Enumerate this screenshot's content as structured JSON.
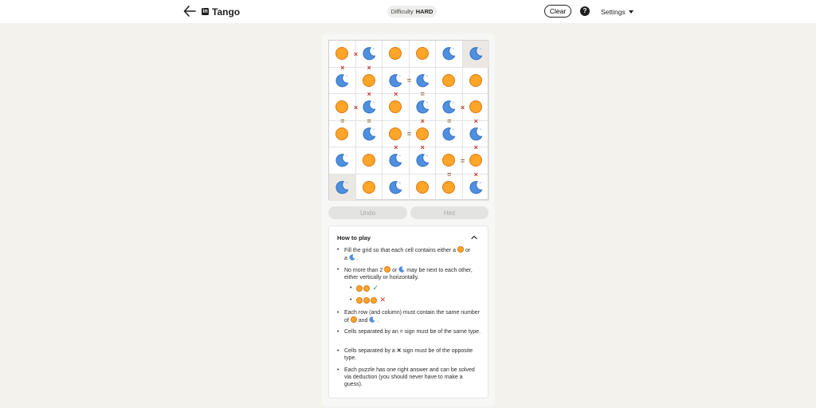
{
  "header": {
    "app_name": "Tango",
    "brand_logo": "in",
    "difficulty_label": "Difficulty",
    "difficulty_value": "HARD",
    "clear_label": "Clear",
    "help_label": "?",
    "settings_label": "Settings"
  },
  "board": {
    "size": 6,
    "cells": [
      [
        "sun",
        "moon",
        "sun",
        "sun",
        "moon",
        "moon"
      ],
      [
        "moon",
        "sun",
        "moon",
        "moon",
        "sun",
        "sun"
      ],
      [
        "sun",
        "moon",
        "sun",
        "moon",
        "moon",
        "sun"
      ],
      [
        "sun",
        "moon",
        "sun",
        "sun",
        "moon",
        "moon"
      ],
      [
        "moon",
        "sun",
        "moon",
        "moon",
        "sun",
        "sun"
      ],
      [
        "moon",
        "sun",
        "moon",
        "sun",
        "sun",
        "moon"
      ]
    ],
    "locked": [
      [
        0,
        5
      ],
      [
        5,
        0
      ]
    ],
    "h_signs": [
      {
        "row": 0,
        "col": 0,
        "sign": "×"
      },
      {
        "row": 1,
        "col": 2,
        "sign": "="
      },
      {
        "row": 2,
        "col": 0,
        "sign": "×"
      },
      {
        "row": 2,
        "col": 4,
        "sign": "×"
      },
      {
        "row": 3,
        "col": 2,
        "sign": "="
      },
      {
        "row": 4,
        "col": 4,
        "sign": "="
      }
    ],
    "v_signs": [
      {
        "row": 0,
        "col": 0,
        "sign": "×"
      },
      {
        "row": 0,
        "col": 1,
        "sign": "×"
      },
      {
        "row": 1,
        "col": 1,
        "sign": "×"
      },
      {
        "row": 1,
        "col": 2,
        "sign": "×"
      },
      {
        "row": 1,
        "col": 3,
        "sign": "="
      },
      {
        "row": 2,
        "col": 0,
        "sign": "="
      },
      {
        "row": 2,
        "col": 1,
        "sign": "="
      },
      {
        "row": 2,
        "col": 3,
        "sign": "×"
      },
      {
        "row": 2,
        "col": 4,
        "sign": "="
      },
      {
        "row": 2,
        "col": 5,
        "sign": "×"
      },
      {
        "row": 3,
        "col": 2,
        "sign": "×"
      },
      {
        "row": 3,
        "col": 3,
        "sign": "×"
      },
      {
        "row": 3,
        "col": 5,
        "sign": "×"
      },
      {
        "row": 4,
        "col": 4,
        "sign": "="
      },
      {
        "row": 4,
        "col": 5,
        "sign": "×"
      }
    ]
  },
  "controls": {
    "undo_label": "Undo",
    "hint_label": "Hint"
  },
  "how_to_play": {
    "title": "How to play",
    "rule1_a": "Fill the grid so that each cell contains either a",
    "rule1_b": "or",
    "rule1_c": "a",
    "rule1_d": ".",
    "rule2_a": "No more than 2",
    "rule2_b": "or",
    "rule2_c": "may be next to each other, either vertically or horizontally.",
    "rule3_a": "Each row (and column) must contain the same number of",
    "rule3_b": "and",
    "rule3_c": ".",
    "rule4": "Cells separated by an = sign must be of the same type.",
    "rule5_a": "Cells separated by a",
    "rule5_b": "sign must be of the opposite type.",
    "rule6": "Each puzzle has one right answer and can be solved via deduction (you should never have to make a guess).",
    "example_ok_mark": "✓",
    "example_bad_mark": "✕",
    "x_symbol": "✕"
  },
  "icons": {
    "back": "arrow-left-icon",
    "help": "question-circle-icon",
    "settings_caret": "caret-down-icon",
    "collapse": "chevron-up-icon"
  },
  "colors": {
    "sun_fill": "#ffa628",
    "moon_fill": "#4f8fe0",
    "sign_x": "#c0392b"
  }
}
